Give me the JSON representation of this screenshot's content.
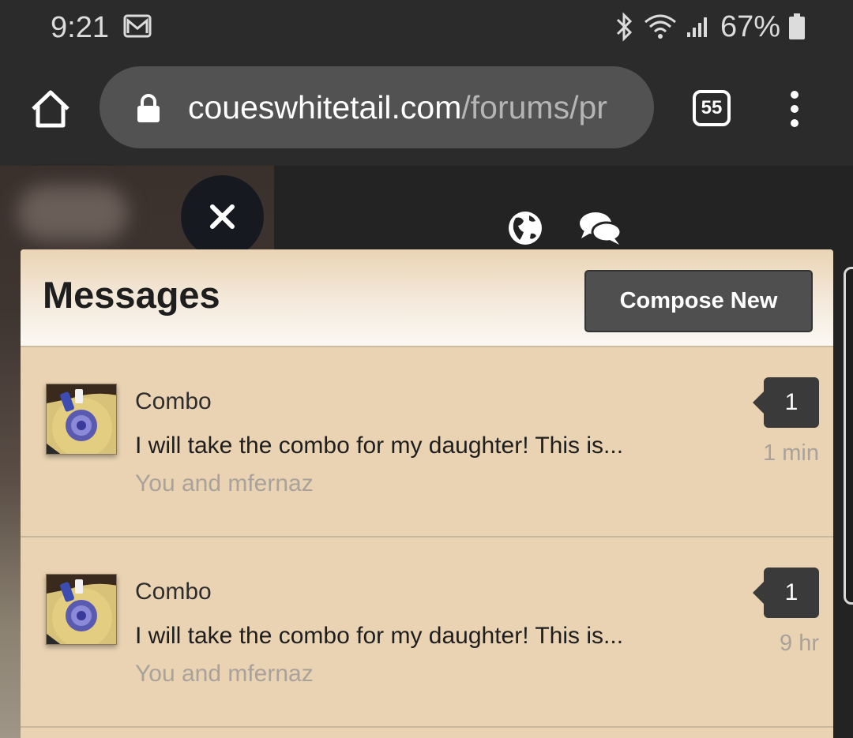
{
  "status_bar": {
    "time": "9:21",
    "battery": "67%",
    "icons": [
      "gmail-icon",
      "bluetooth-icon",
      "wifi-icon",
      "signal-icon",
      "battery-icon"
    ]
  },
  "browser": {
    "url_domain": "coueswhitetail.com",
    "url_path": "/forums/pr",
    "tab_count": "55",
    "icons": [
      "home-icon",
      "lock-icon",
      "tabs-icon",
      "more-vert-icon"
    ]
  },
  "nav": {
    "icons": [
      "close-icon",
      "globe-icon",
      "chat-bubbles-icon"
    ]
  },
  "messages_panel": {
    "title": "Messages",
    "compose_label": "Compose New",
    "conversations": [
      {
        "title": "Combo",
        "snippet": "I will take the combo for my daughter! This is...",
        "participants": "You and mfernaz",
        "count": "1",
        "time": "1 min"
      },
      {
        "title": "Combo",
        "snippet": "I will take the combo for my daughter! This is...",
        "participants": "You and mfernaz",
        "count": "1",
        "time": "9 hr"
      }
    ]
  },
  "colors": {
    "panel_bg": "#ead3b3",
    "compose_button": "#4f4f4f",
    "browser_bar": "#2b2b2b",
    "url_pill": "#525252",
    "badge": "#3a3a3a"
  }
}
